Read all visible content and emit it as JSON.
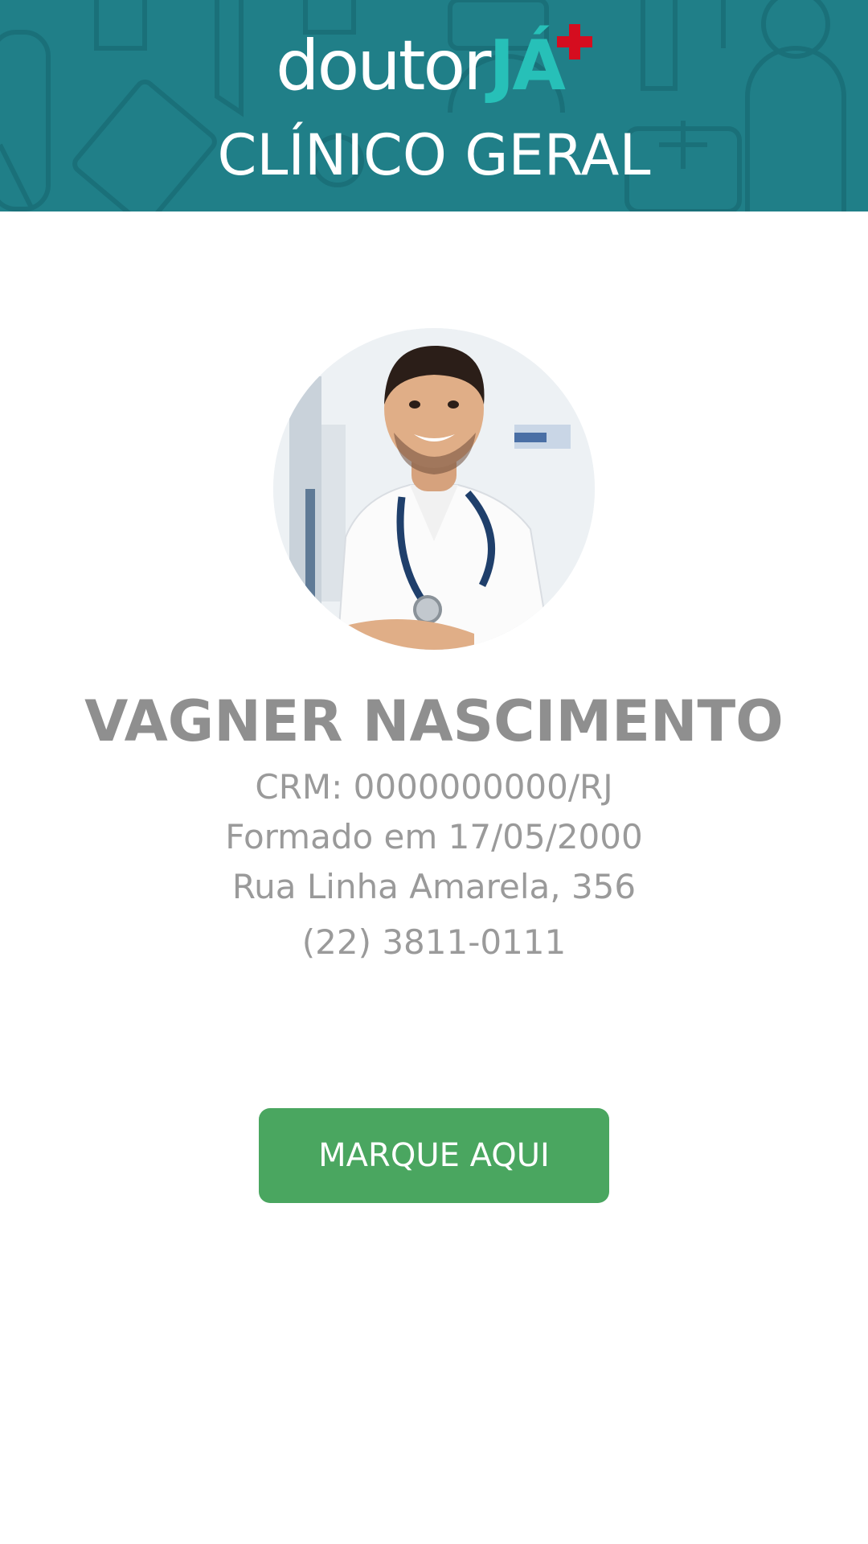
{
  "header": {
    "logo_part1": "doutor",
    "logo_part2": "JÁ",
    "specialty": "CLÍNICO GERAL",
    "bg_color": "#207f88",
    "accent_color": "#27c0b8",
    "plus_color": "#d50d1f"
  },
  "doctor": {
    "photo_icon": "doctor-photo",
    "name": "VAGNER NASCIMENTO",
    "crm": "CRM: 0000000000/RJ",
    "graduation": "Formado em 17/05/2000",
    "address": "Rua Linha Amarela, 356",
    "phone": "(22) 3811-0111"
  },
  "cta": {
    "label": "MARQUE AQUI",
    "color": "#4aa660"
  }
}
